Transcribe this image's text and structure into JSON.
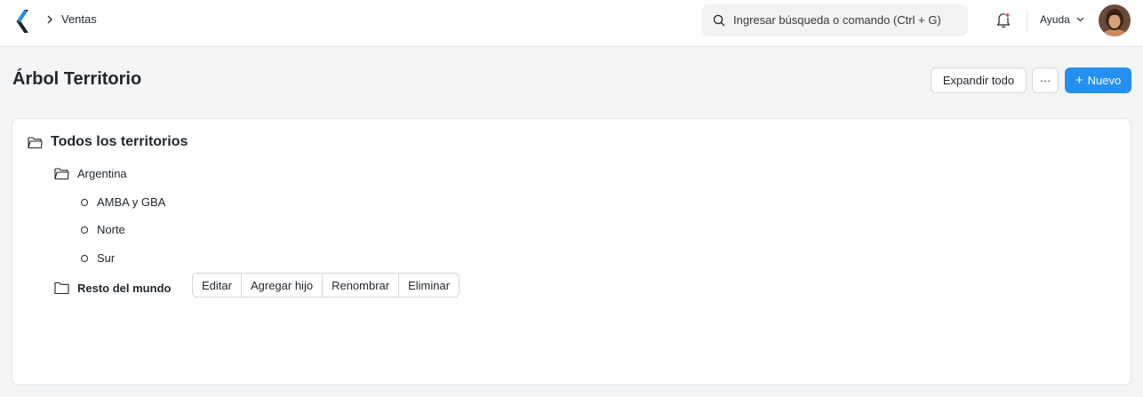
{
  "navbar": {
    "breadcrumb": [
      "Ventas"
    ],
    "search": {
      "placeholder": "Ingresar búsqueda o comando (Ctrl + G)"
    },
    "help_label": "Ayuda",
    "icons": [
      "app-logo-icon",
      "chevron-right-icon",
      "search-icon",
      "bell-icon",
      "chevron-down-icon"
    ]
  },
  "page": {
    "title": "Árbol Territorio",
    "buttons": {
      "expand_all": "Expandir todo",
      "more": "···",
      "new_plus": "+",
      "new_label": "Nuevo"
    }
  },
  "tree": {
    "root": "Todos los territorios",
    "nodes": [
      {
        "label": "Argentina",
        "children": [
          "AMBA y GBA",
          "Norte",
          "Sur"
        ]
      },
      {
        "label": "Resto del mundo",
        "selected": true
      }
    ],
    "actions": [
      "Editar",
      "Agregar hijo",
      "Renombrar",
      "Eliminar"
    ]
  },
  "colors": {
    "primary": "#2490ef",
    "text": "#1f272e",
    "background": "#f4f5f6",
    "border": "#d1d8dd"
  }
}
